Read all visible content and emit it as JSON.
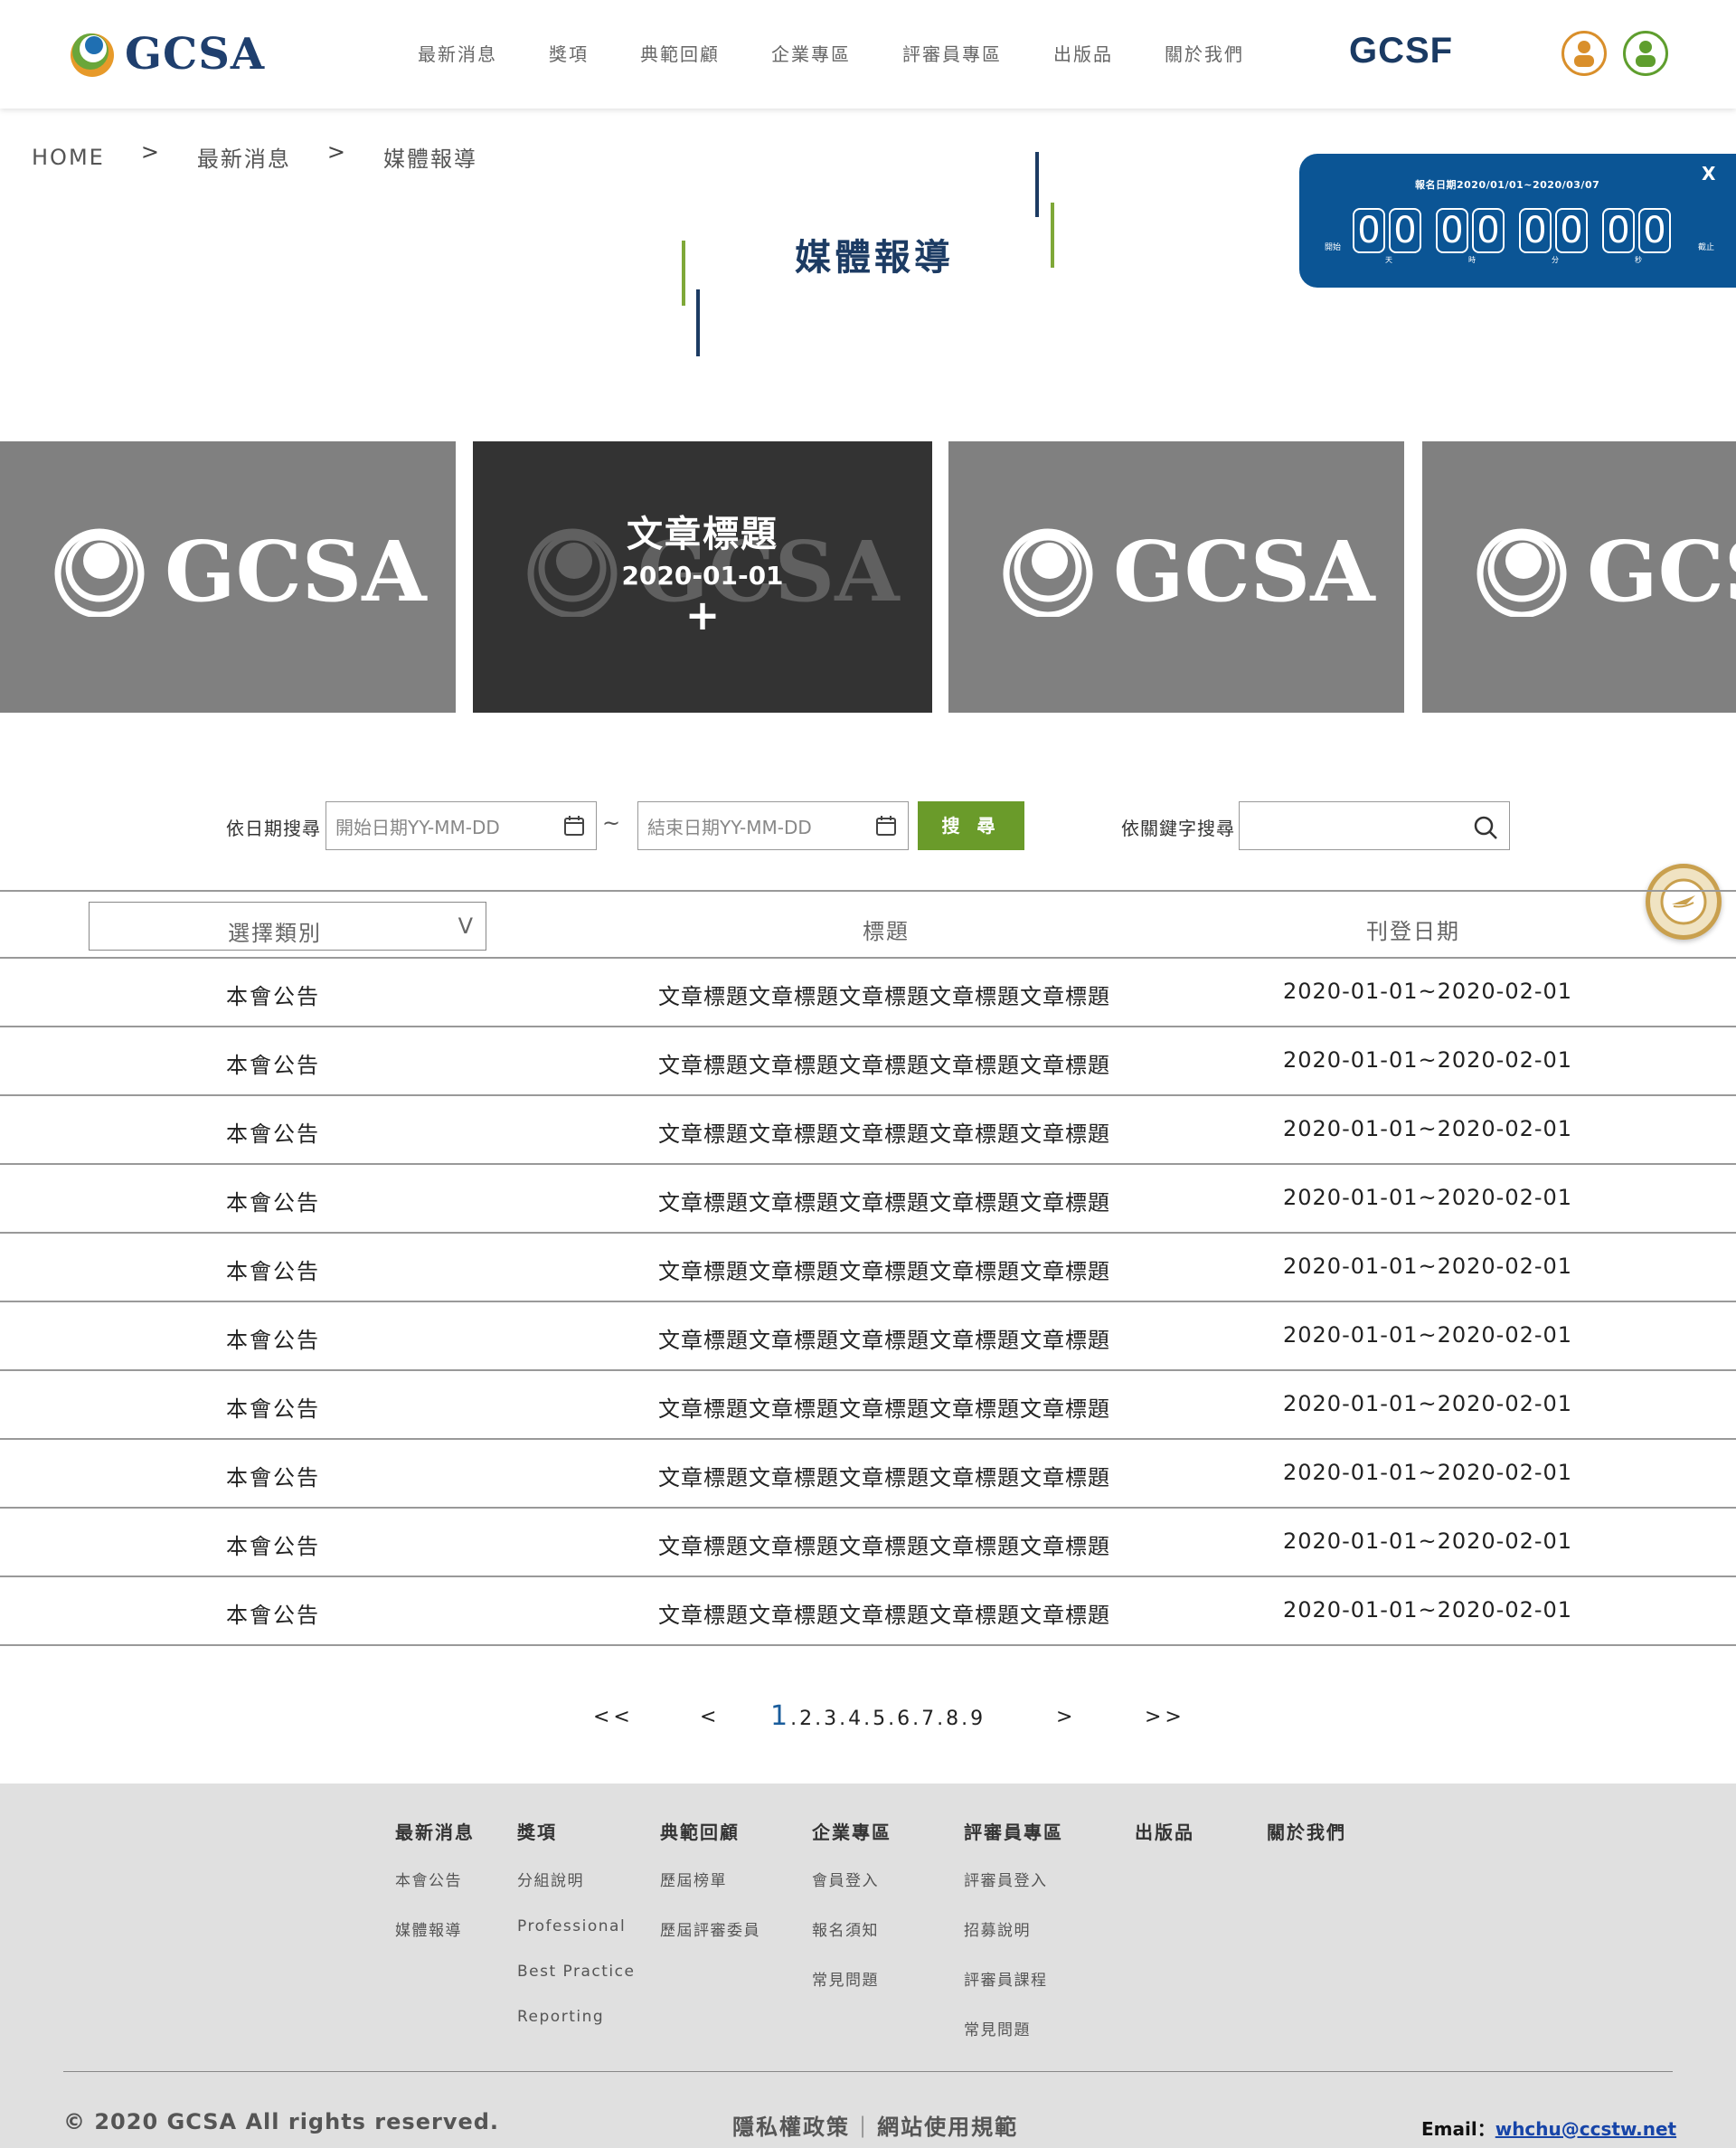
{
  "header": {
    "logo_text": "GCSA",
    "nav": [
      "最新消息",
      "獎項",
      "典範回顧",
      "企業專區",
      "評審員專區",
      "出版品",
      "關於我們"
    ],
    "brand_right": "GCSF"
  },
  "breadcrumb": [
    "HOME",
    "最新消息",
    "媒體報導"
  ],
  "breadcrumb_sep": ">",
  "page_title": "媒體報導",
  "countdown": {
    "title": "報名日期2020/01/01~2020/03/07",
    "close": "X",
    "start_label": "開始",
    "end_label": "截止",
    "groups": [
      {
        "digits": [
          "0",
          "0"
        ],
        "unit": "天"
      },
      {
        "digits": [
          "0",
          "0"
        ],
        "unit": "時"
      },
      {
        "digits": [
          "0",
          "0"
        ],
        "unit": "分"
      },
      {
        "digits": [
          "0",
          "0"
        ],
        "unit": "秒"
      }
    ]
  },
  "carousel": {
    "logo_text": "GCSA",
    "active": {
      "title": "文章標題",
      "date": "2020-01-01",
      "plus": "+"
    }
  },
  "search": {
    "date_label": "依日期搜尋",
    "start_placeholder": "開始日期YY-MM-DD",
    "tilde": "~",
    "end_placeholder": "結束日期YY-MM-DD",
    "button": "搜 尋",
    "keyword_label": "依關鍵字搜尋",
    "keyword_value": ""
  },
  "table": {
    "category_select": "選擇類別",
    "select_arrow": "V",
    "headers": [
      "標題",
      "刊登日期"
    ],
    "rows": [
      {
        "category": "本會公告",
        "title": "文章標題文章標題文章標題文章標題文章標題",
        "date": "2020-01-01~2020-02-01"
      },
      {
        "category": "本會公告",
        "title": "文章標題文章標題文章標題文章標題文章標題",
        "date": "2020-01-01~2020-02-01"
      },
      {
        "category": "本會公告",
        "title": "文章標題文章標題文章標題文章標題文章標題",
        "date": "2020-01-01~2020-02-01"
      },
      {
        "category": "本會公告",
        "title": "文章標題文章標題文章標題文章標題文章標題",
        "date": "2020-01-01~2020-02-01"
      },
      {
        "category": "本會公告",
        "title": "文章標題文章標題文章標題文章標題文章標題",
        "date": "2020-01-01~2020-02-01"
      },
      {
        "category": "本會公告",
        "title": "文章標題文章標題文章標題文章標題文章標題",
        "date": "2020-01-01~2020-02-01"
      },
      {
        "category": "本會公告",
        "title": "文章標題文章標題文章標題文章標題文章標題",
        "date": "2020-01-01~2020-02-01"
      },
      {
        "category": "本會公告",
        "title": "文章標題文章標題文章標題文章標題文章標題",
        "date": "2020-01-01~2020-02-01"
      },
      {
        "category": "本會公告",
        "title": "文章標題文章標題文章標題文章標題文章標題",
        "date": "2020-01-01~2020-02-01"
      },
      {
        "category": "本會公告",
        "title": "文章標題文章標題文章標題文章標題文章標題",
        "date": "2020-01-01~2020-02-01"
      }
    ]
  },
  "pagination": {
    "first": "<<",
    "prev": "<",
    "pages": [
      "1",
      "2",
      "3",
      "4",
      "5",
      "6",
      "7",
      "8",
      "9"
    ],
    "separator": ".",
    "current": "1",
    "next": ">",
    "last": ">>"
  },
  "footer": {
    "columns": [
      {
        "heading": "最新消息",
        "links": [
          "本會公告",
          "媒體報導"
        ]
      },
      {
        "heading": "獎項",
        "links": [
          "分組說明",
          "Professional",
          "Best Practice",
          "Reporting"
        ]
      },
      {
        "heading": "典範回顧",
        "links": [
          "歷屆榜單",
          "歷屆評審委員"
        ]
      },
      {
        "heading": "企業專區",
        "links": [
          "會員登入",
          "報名須知",
          "常見問題"
        ]
      },
      {
        "heading": "評審員專區",
        "links": [
          "評審員登入",
          "招募說明",
          "評審員課程",
          "常見問題"
        ]
      },
      {
        "heading": "出版品",
        "links": []
      },
      {
        "heading": "關於我們",
        "links": []
      }
    ],
    "copyright": "© 2020 GCSA All rights reserved.",
    "privacy": "隱私權政策",
    "policy_divider": "|",
    "terms": "網站使用規範",
    "email_label": "Email：",
    "email": "whchu@ccstw.net"
  },
  "colors": {
    "brand_navy": "#1c3b63",
    "countdown_blue": "#0b5595",
    "search_green": "#6a9b2a",
    "user_orange": "#d98f2b",
    "user_green": "#5f9e2e",
    "footer_bg": "#e0e0e0",
    "current_page_blue": "#1a5d9c"
  },
  "icons": [
    "gcsa-logo-icon",
    "user-icon",
    "calendar-icon",
    "search-icon",
    "assistant-icon"
  ]
}
